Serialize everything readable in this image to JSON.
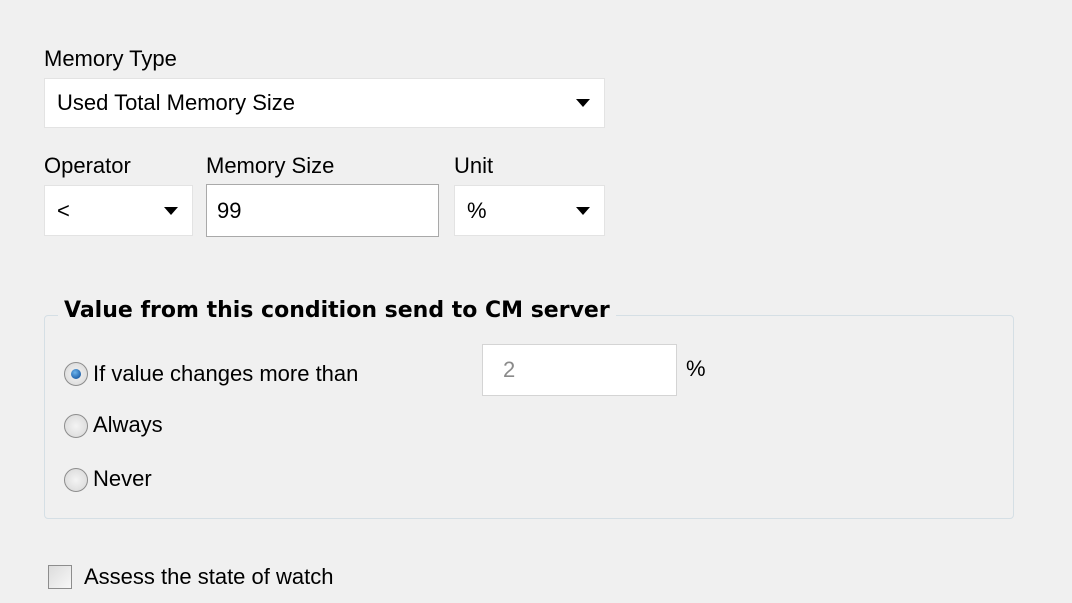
{
  "memory_type": {
    "label": "Memory Type",
    "selected": "Used Total Memory Size"
  },
  "operator": {
    "label": "Operator",
    "selected": "<"
  },
  "memory_size": {
    "label": "Memory Size",
    "value": "99"
  },
  "unit": {
    "label": "Unit",
    "selected": "%"
  },
  "send_group": {
    "title": "Value from this condition send to CM server",
    "options": [
      {
        "label": "If value changes more than",
        "checked": true
      },
      {
        "label": "Always",
        "checked": false
      },
      {
        "label": "Never",
        "checked": false
      }
    ],
    "threshold_value": "2",
    "threshold_unit": "%"
  },
  "assess_checkbox": {
    "label": "Assess the state of watch",
    "checked": false
  }
}
